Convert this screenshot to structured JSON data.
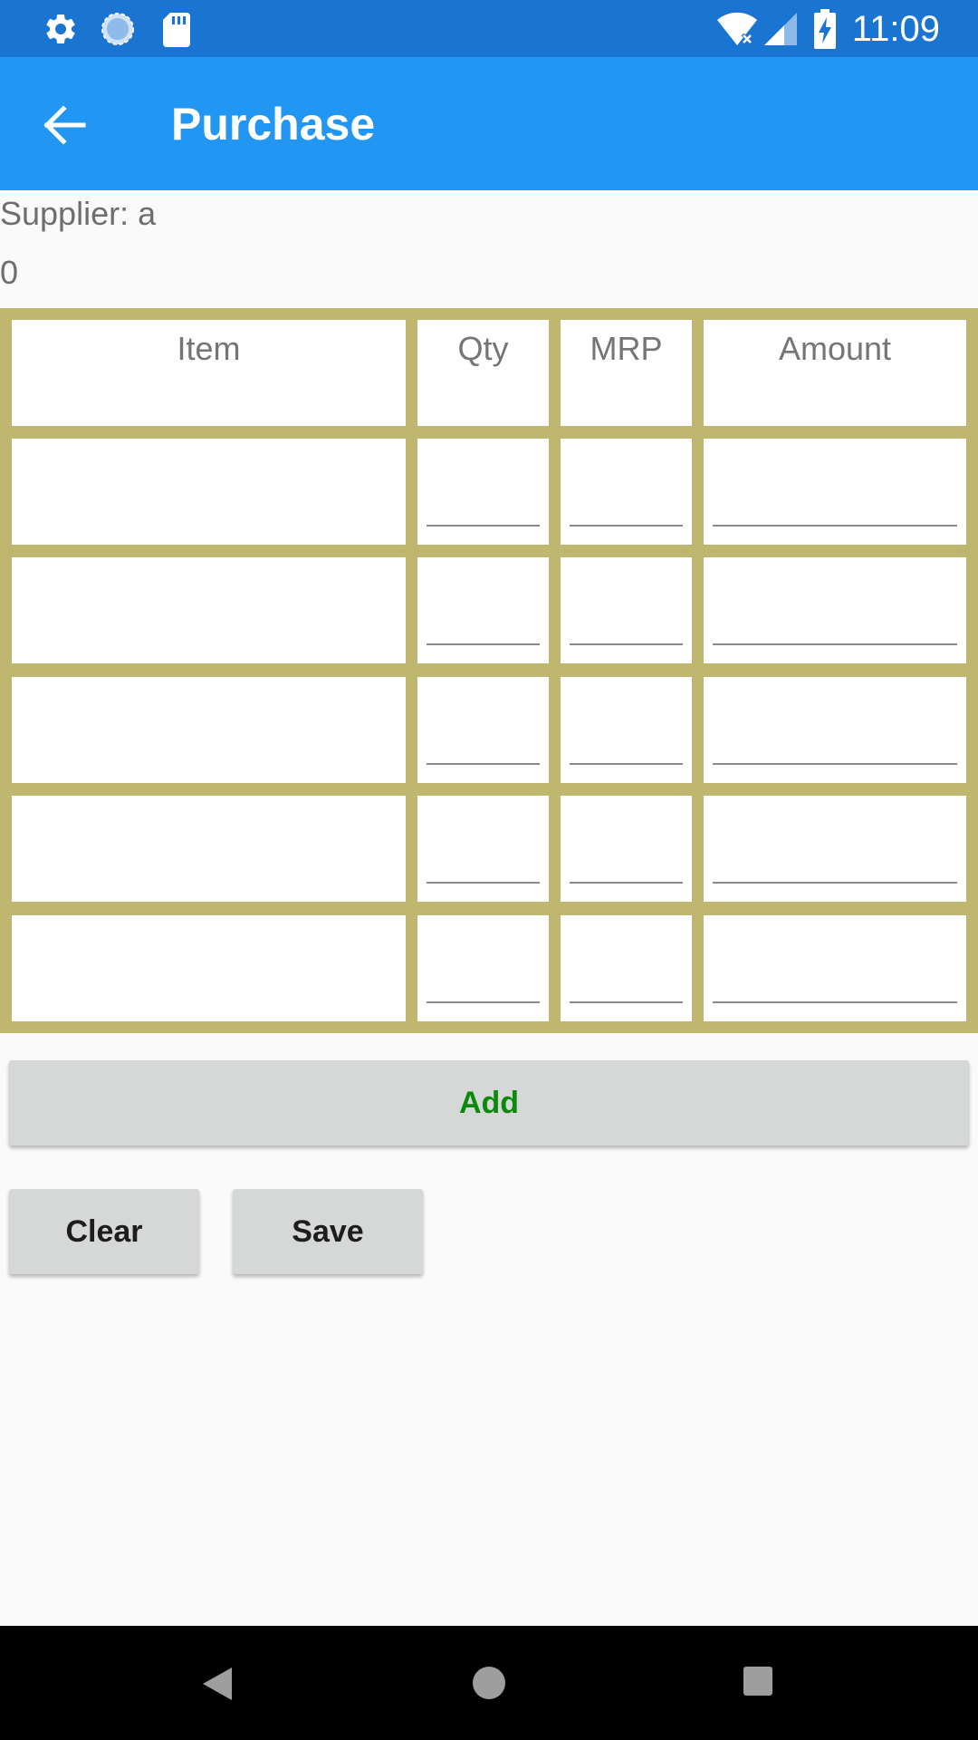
{
  "status_bar": {
    "time": "11:09",
    "left_icons": [
      "gear-icon",
      "sync-icon",
      "sd-card-icon"
    ],
    "right_icons": [
      "wifi-icon",
      "signal-icon",
      "battery-charging-icon"
    ]
  },
  "app_bar": {
    "title": "Purchase",
    "back_icon": "arrow-left-icon"
  },
  "info": {
    "supplier": "Supplier: a",
    "count": "0"
  },
  "table": {
    "headers": [
      "Item",
      "Qty",
      "MRP",
      "Amount"
    ],
    "rows": [
      {
        "item": "",
        "qty": "",
        "mrp": "",
        "amount": ""
      },
      {
        "item": "",
        "qty": "",
        "mrp": "",
        "amount": ""
      },
      {
        "item": "",
        "qty": "",
        "mrp": "",
        "amount": ""
      },
      {
        "item": "",
        "qty": "",
        "mrp": "",
        "amount": ""
      },
      {
        "item": "",
        "qty": "",
        "mrp": "",
        "amount": ""
      }
    ]
  },
  "buttons": {
    "add": "Add",
    "clear": "Clear",
    "save": "Save"
  },
  "nav_bar": {
    "icons": [
      "back-triangle-icon",
      "home-circle-icon",
      "recents-square-icon"
    ]
  },
  "colors": {
    "status_bar": "#1a75d2",
    "app_bar": "#2196f3",
    "grid_border": "#bfb76f",
    "add_text": "#0b8a0b",
    "button_bg": "#d6d7d7"
  }
}
